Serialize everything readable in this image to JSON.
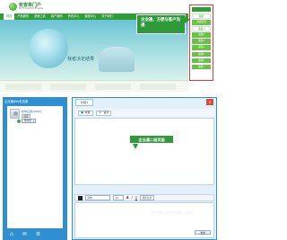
{
  "site": {
    "logo_cn": "有客来门户",
    "logo_en": "EP Promotion Engine",
    "nav": [
      "首页",
      "产品服务",
      "营销工具",
      "客户案例",
      "资讯中心",
      "客服中心",
      "关于我们"
    ],
    "banner_text": "我者决定结果",
    "callout": "企业通，方便与客户沟通",
    "side_widget_items": [
      "客服",
      "在线咨询",
      "客服1",
      "客服2",
      "客服3",
      "客服4",
      "客服5",
      "客服6",
      "客服7"
    ]
  },
  "im": {
    "left_title": "企业通Web在线通",
    "user_name": "新信息通(2889)",
    "user_button": "设置",
    "status": "我在线",
    "chat_tab": "对话1",
    "toolbar": [
      "视频",
      "语音"
    ],
    "green_tag": "企业通二级页面",
    "font_name": "宋体",
    "font_size": "12",
    "chat_record": "消息记录",
    "send_label": "发送"
  },
  "watermark": "www.baimao.com"
}
